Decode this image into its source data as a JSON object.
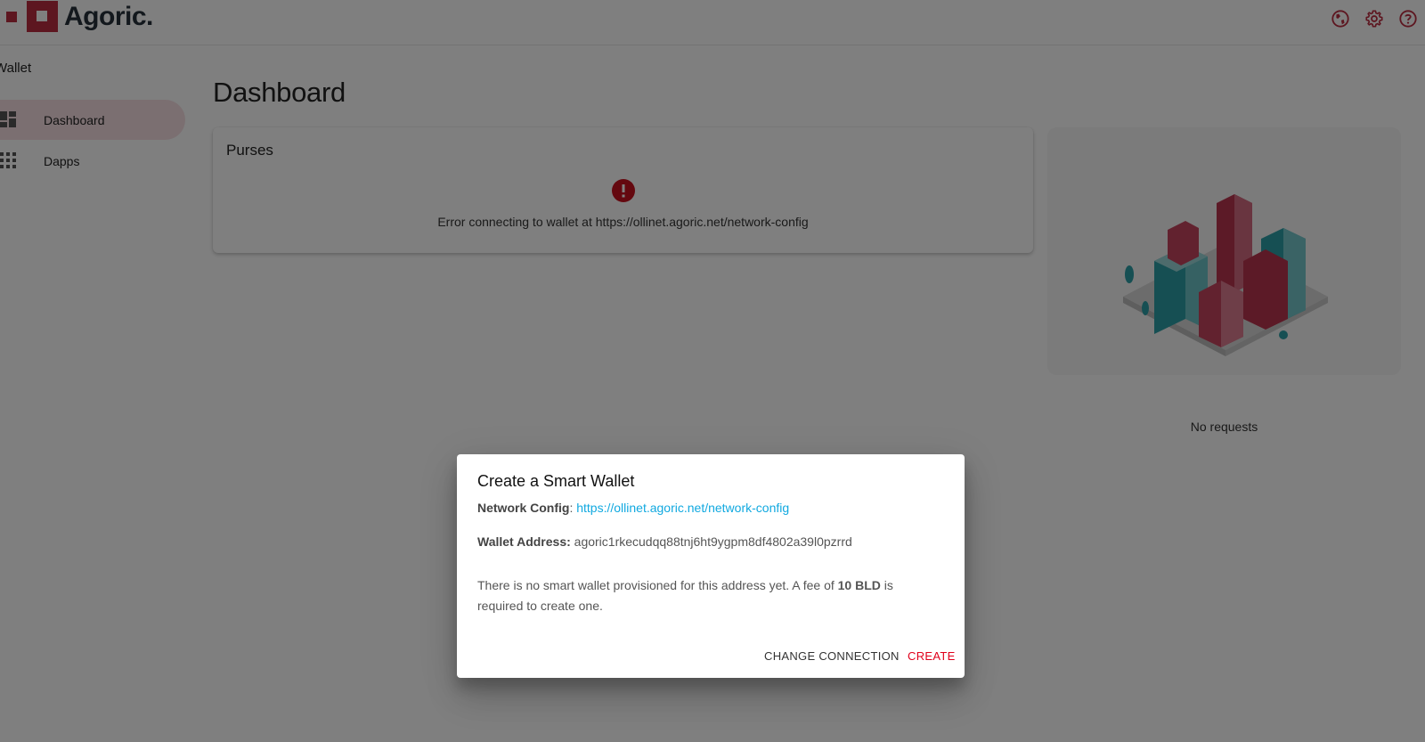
{
  "header": {
    "brand": "Agoric.",
    "icons": [
      "globe-icon",
      "gear-icon",
      "help-icon"
    ],
    "accent_color": "#bb2d40"
  },
  "sidebar": {
    "title": "Wallet",
    "items": [
      {
        "label": "Dashboard",
        "icon": "dashboard-icon",
        "active": true
      },
      {
        "label": "Dapps",
        "icon": "apps-grid-icon",
        "active": false
      }
    ]
  },
  "main": {
    "title": "Dashboard",
    "purses": {
      "title": "Purses",
      "error_text": "Error connecting to wallet at https://ollinet.agoric.net/network-config"
    },
    "requests": {
      "empty_text": "No requests"
    }
  },
  "dialog": {
    "title": "Create a Smart Wallet",
    "network_config_label": "Network Config",
    "network_config_sep": ": ",
    "network_config_url": "https://ollinet.agoric.net/network-config",
    "wallet_address_label": "Wallet Address:",
    "wallet_address": "agoric1rkecudqq88tnj6ht9ygpm8df4802a39l0pzrrd",
    "message_before": "There is no smart wallet provisioned for this address yet. A fee of ",
    "fee": "10 BLD",
    "message_after": " is required to create one.",
    "change_connection_label": "CHANGE CONNECTION",
    "create_label": "CREATE",
    "link_color": "#11a9e0",
    "create_color": "#e0001b"
  }
}
